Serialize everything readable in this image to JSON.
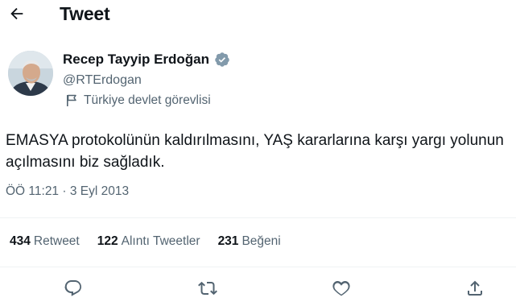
{
  "header": {
    "title": "Tweet"
  },
  "author": {
    "name": "Recep Tayyip Erdoğan",
    "handle": "@RTErdogan",
    "label": "Türkiye devlet görevlisi"
  },
  "tweet": {
    "lines": [
      "EMASYA protokolünün kaldırılmasını, YAŞ kararlarına karşı yargı yolunun",
      "açılmasını biz sağladık."
    ],
    "meta": "ÖÖ 11:21 · 3 Eyl 2013"
  },
  "stats": [
    {
      "count": "434",
      "label": "Retweet"
    },
    {
      "count": "122",
      "label": "Alıntı Tweetler"
    },
    {
      "count": "231",
      "label": "Beğeni"
    }
  ],
  "colors": {
    "verified": "#829aab",
    "text": "#0f1419",
    "muted": "#536471",
    "divider": "#eff3f4"
  },
  "icons": [
    "back-arrow-icon",
    "verified-badge-icon",
    "flag-icon",
    "reply-icon",
    "retweet-icon",
    "like-icon",
    "share-icon"
  ]
}
